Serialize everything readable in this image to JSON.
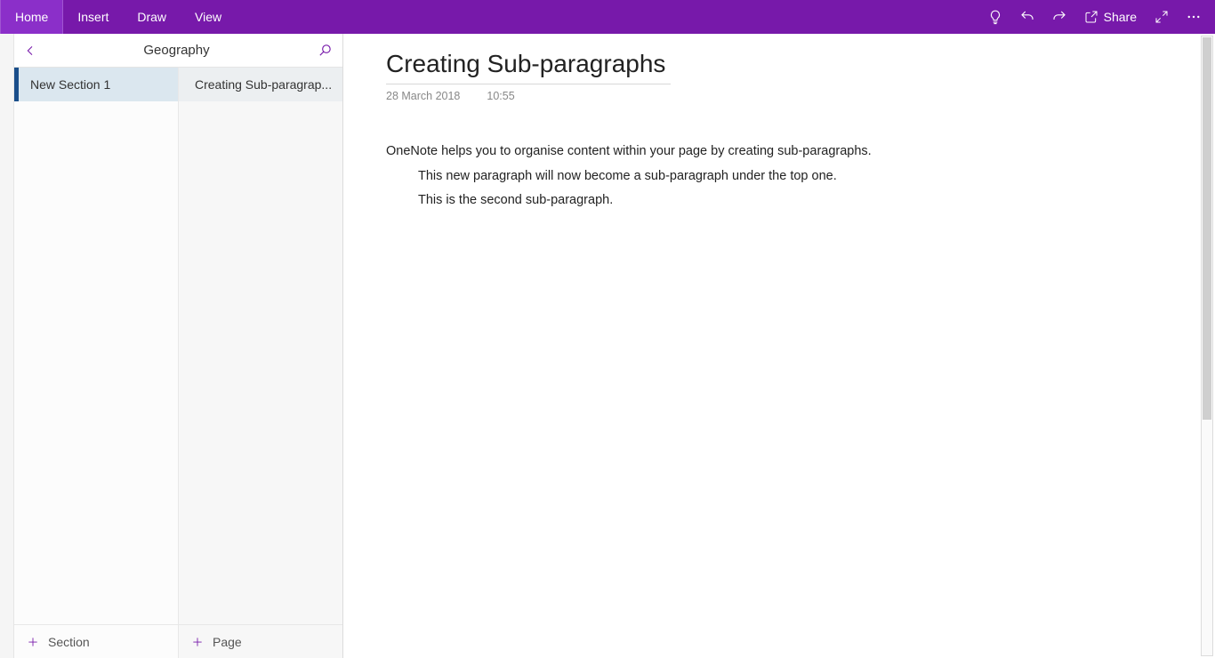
{
  "ribbon": {
    "tabs": [
      "Home",
      "Insert",
      "Draw",
      "View"
    ],
    "active_index": 0,
    "share_label": "Share"
  },
  "nav": {
    "notebook_title": "Geography",
    "sections": [
      {
        "label": "New Section 1",
        "selected": true
      }
    ],
    "pages": [
      {
        "label": "Creating Sub-paragrap...",
        "selected": true
      }
    ],
    "add_section_label": "Section",
    "add_page_label": "Page"
  },
  "page": {
    "title": "Creating Sub-paragraphs",
    "date": "28 March 2018",
    "time": "10:55",
    "body": [
      {
        "text": "OneNote helps you to organise content within your page by creating sub-paragraphs.",
        "indent": 0
      },
      {
        "text": "This new paragraph will now become a sub-paragraph under the top one.",
        "indent": 1
      },
      {
        "text": "This is the second sub-paragraph.",
        "indent": 1
      }
    ]
  }
}
